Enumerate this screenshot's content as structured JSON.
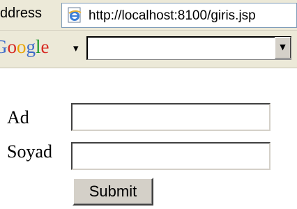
{
  "browser": {
    "address_label": "ddress",
    "url": "http://localhost:8100/giris.jsp",
    "page_icon": "ie-page-icon"
  },
  "google_toolbar": {
    "logo_letters": [
      "G",
      "o",
      "o",
      "g",
      "l",
      "e"
    ],
    "menu_arrow": "▾",
    "search_value": "",
    "dropdown_arrow": "▼"
  },
  "form": {
    "fields": [
      {
        "label": "Ad",
        "value": ""
      },
      {
        "label": "Soyad",
        "value": ""
      }
    ],
    "submit_label": "Submit"
  },
  "colors": {
    "chrome_background": "#ece9d8",
    "button_face": "#d4d0c8",
    "address_border": "#7f9db9"
  }
}
